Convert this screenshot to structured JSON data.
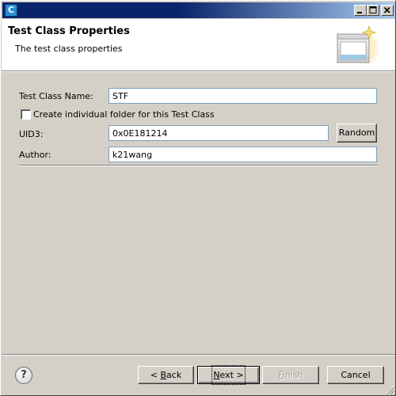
{
  "titlebar": {
    "icon_letter": "C",
    "icon": "app-c-icon",
    "controls": [
      "minimize-icon",
      "maximize-icon",
      "close-icon"
    ]
  },
  "banner": {
    "title": "Test Class Properties",
    "description": "The test class properties",
    "image": "wizard-banner-icon"
  },
  "form": {
    "class_name_label": "Test Class Name:",
    "class_name_value": "STF",
    "folder_checkbox_label": "Create individual folder for this Test Class",
    "folder_checkbox_checked": false,
    "uid_label": "UID3:",
    "uid_value": "0x0E181214",
    "random_button": "Random",
    "author_label": "Author:",
    "author_value": "k21wang"
  },
  "footer": {
    "help_glyph": "?",
    "back_prefix": "< ",
    "back_mnemonic": "B",
    "back_rest": "ack",
    "next_mnemonic": "N",
    "next_rest": "ext >",
    "finish_mnemonic": "F",
    "finish_rest": "inish",
    "finish_enabled": false,
    "cancel": "Cancel"
  }
}
